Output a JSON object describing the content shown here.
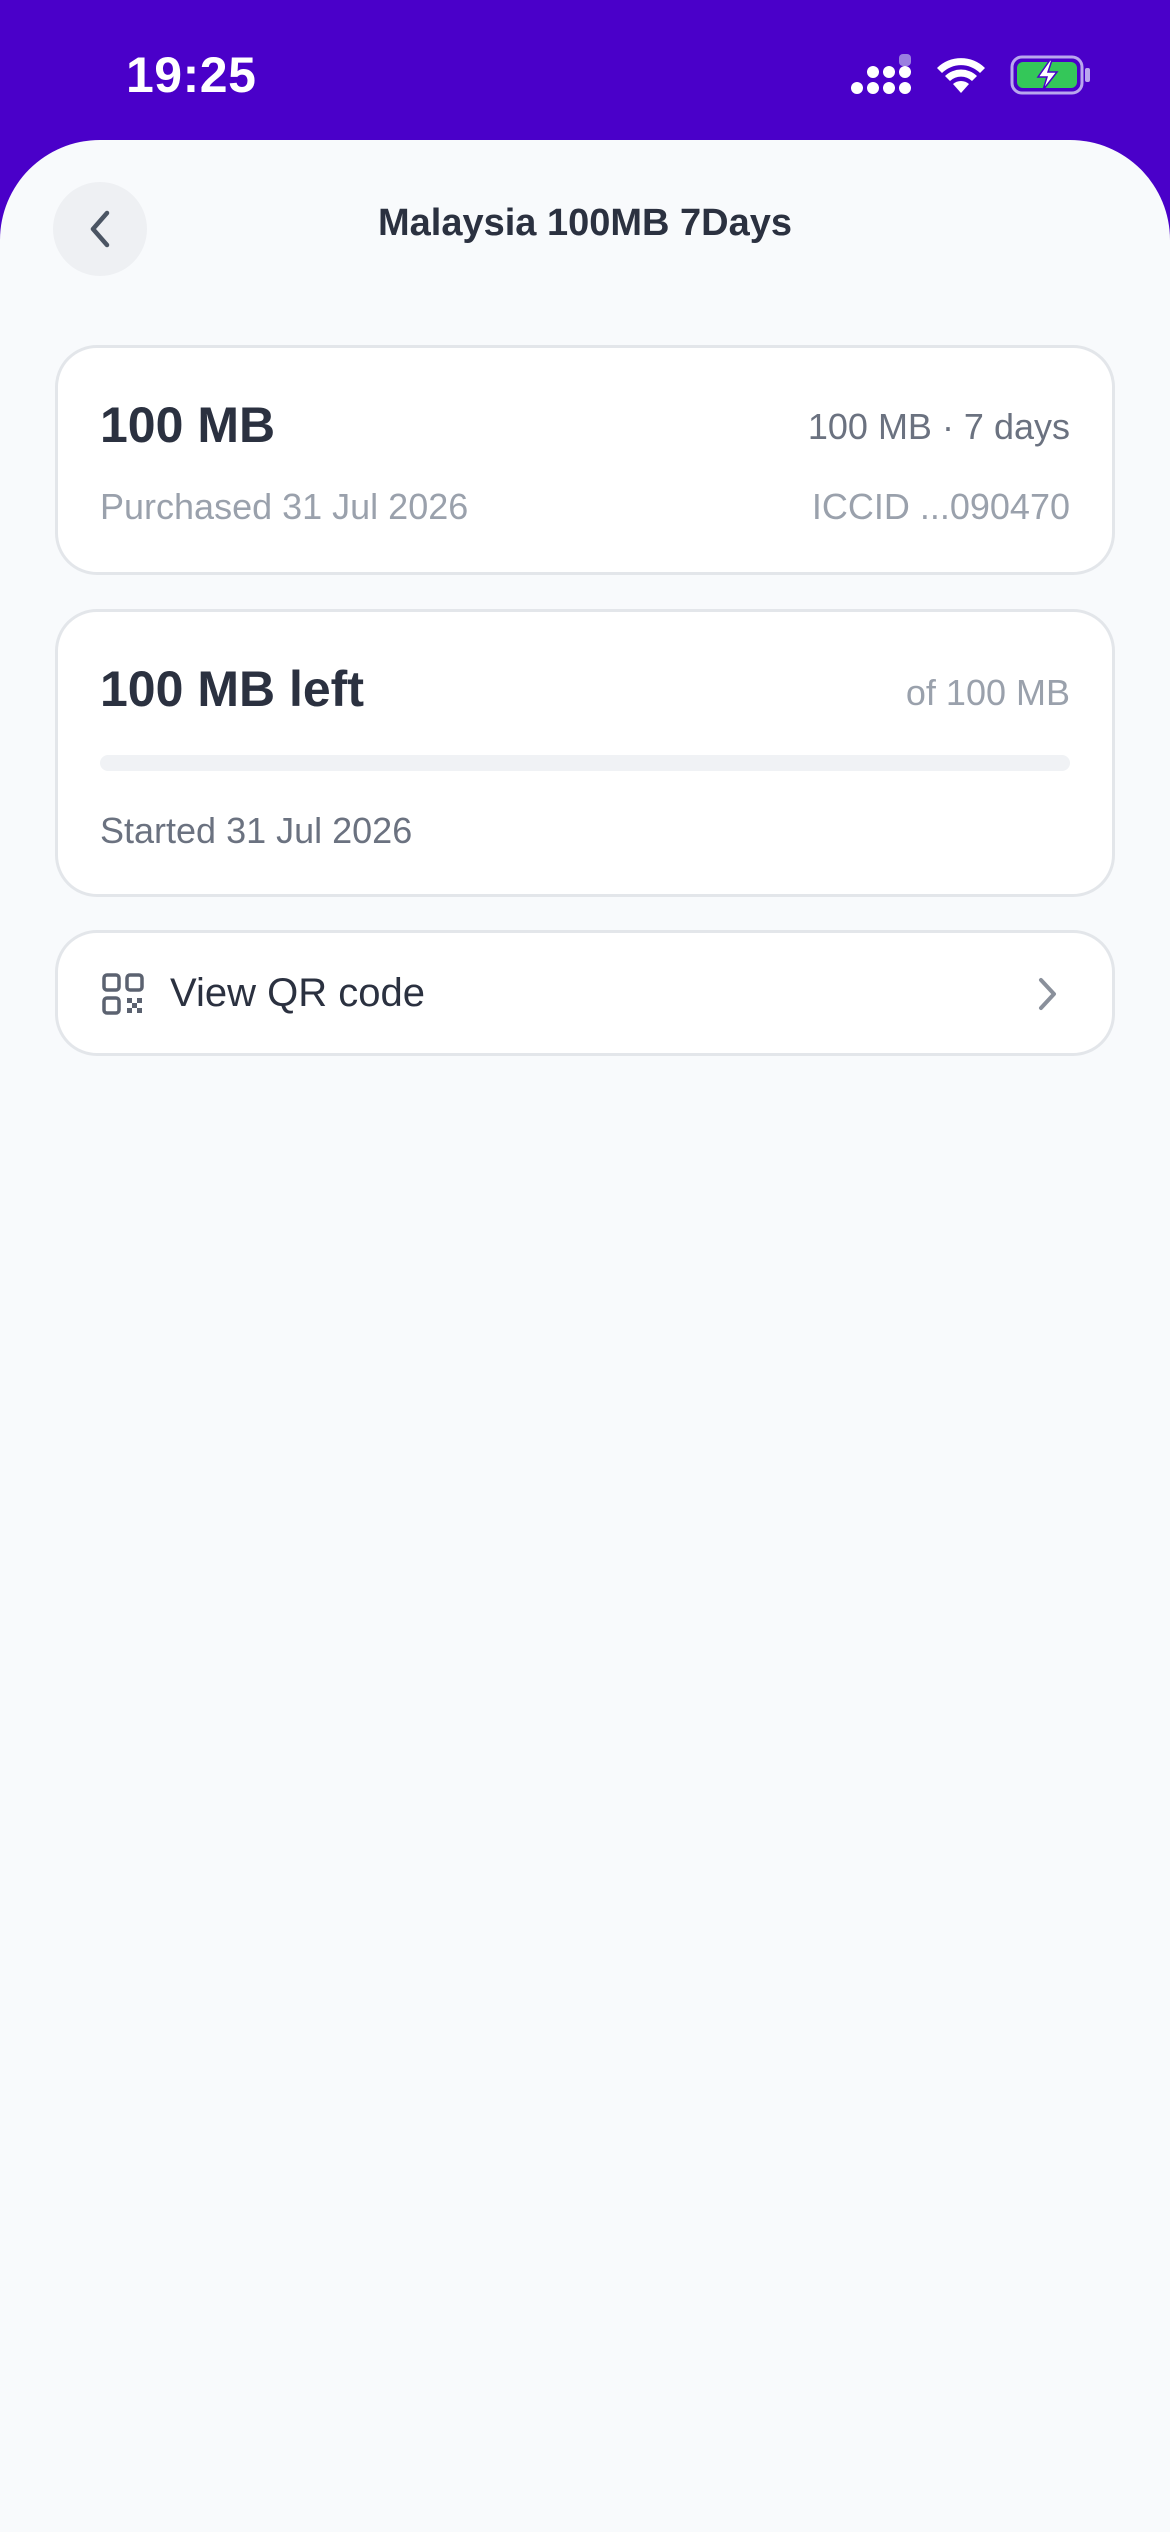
{
  "status_bar": {
    "time": "19:25",
    "icons": [
      "cellular-signal-icon",
      "wifi-icon",
      "battery-charging-icon"
    ],
    "battery_color": "#34c759"
  },
  "header": {
    "title": "Malaysia 100MB 7Days",
    "back_icon": "chevron-left-icon"
  },
  "plan_card": {
    "name": "100 MB",
    "meta": "100 MB · 7 days",
    "purchased": "Purchased 31 Jul 2026",
    "iccid": "ICCID ...090470"
  },
  "usage_card": {
    "left": "100 MB left",
    "of_total": "of 100 MB",
    "used_percent": 0,
    "started": "Started 31 Jul 2026"
  },
  "qr_row": {
    "icon": "qr-code-icon",
    "label": "View QR code",
    "chevron": "chevron-right-icon"
  },
  "colors": {
    "accent": "#4a00c9",
    "background": "#f8fafc",
    "card": "#ffffff",
    "text_primary": "#2b3140",
    "text_secondary": "#6b7280"
  }
}
